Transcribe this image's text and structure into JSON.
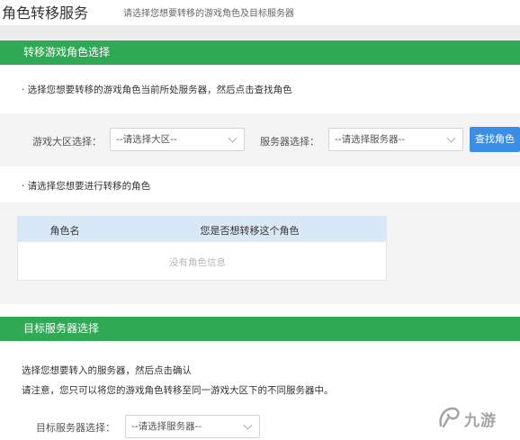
{
  "page": {
    "title": "角色转移服务",
    "subtitle": "请选择您想要转移的游戏角色及目标服务器"
  },
  "section1": {
    "header": "转移游戏角色选择",
    "instruction": "· 选择您想要转移的游戏角色当前所处服务器，然后点击查找角色",
    "region_label": "游戏大区选择：",
    "region_select": "--请选择大区--",
    "server_label": "服务器选择：",
    "server_select": "--请选择服务器--",
    "search_button": "查找角色",
    "role_instruction": "· 请选择您想要进行转移的角色",
    "table": {
      "col_name": "角色名",
      "col_confirm": "您是否想转移这个角色",
      "empty_text": "没有角色信息"
    }
  },
  "section2": {
    "header": "目标服务器选择",
    "line1": "选择您想要转入的服务器，然后点击确认",
    "line2": "请注意，您只可以将您的游戏角色转移至同一游戏大区下的不同服务器中。",
    "target_label": "目标服务器选择：",
    "target_select": "--请选择服务器--"
  },
  "watermark": {
    "text": "九游",
    "icon": "jiuyou-logo-icon"
  },
  "colors": {
    "section_header": "#2fa954",
    "button": "#3a8ee6",
    "table_header": "#d9e8f7",
    "panel_gray": "#f4f4f4"
  }
}
